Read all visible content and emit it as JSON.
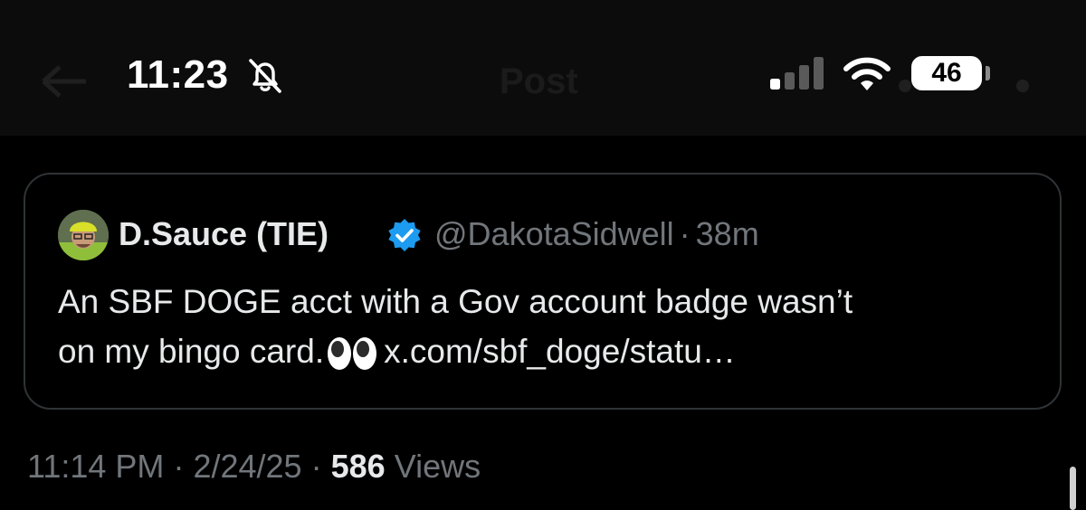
{
  "status_bar": {
    "time": "11:23",
    "battery": "46"
  },
  "nav": {
    "title": "Post"
  },
  "quote": {
    "display_name": "D.Sauce (TIE)",
    "handle": "@DakotaSidwell",
    "separator": "·",
    "age": "38m",
    "text_line1": "An SBF DOGE acct with a Gov account badge wasn’t",
    "text_line2_before": "on my bingo card.",
    "link": "x.com/sbf_doge/statu…"
  },
  "post_meta": {
    "time": "11:14 PM",
    "sep1": "·",
    "date": "2/24/25",
    "sep2": "·",
    "views_count": "586",
    "views_label": "Views"
  },
  "colors": {
    "background": "#000000",
    "text": "#e7e9ea",
    "muted": "#71767b",
    "verified_blue": "#1d9bf0",
    "border": "#2f3336"
  },
  "icons": [
    "bell-slash-icon",
    "cellular-signal-icon",
    "wifi-icon",
    "battery-icon",
    "verified-badge-icon",
    "eyes-emoji"
  ]
}
